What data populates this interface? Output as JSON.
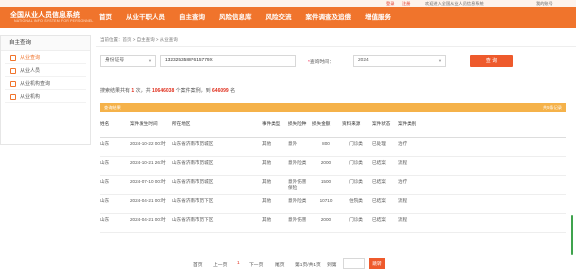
{
  "top_bar": {
    "login": "登录",
    "register": "注册",
    "welcome": "欢迎进入全国从业人员信息系统",
    "my_account": "我的账号"
  },
  "header": {
    "title": "全国从业人员信息系统",
    "subtitle": "NATIONAL INFO SYSTEM FOR PERSONNEL"
  },
  "nav": [
    "首页",
    "从业干职人员",
    "自主查询",
    "风险信息库",
    "风险交流",
    "案件调查及追偿",
    "增值服务"
  ],
  "sidebar": {
    "title": "自主查询",
    "items": [
      {
        "label": "从业查询",
        "active": true
      },
      {
        "label": "从业人员",
        "active": false
      },
      {
        "label": "从业机构查询",
        "active": false
      },
      {
        "label": "从业机构",
        "active": false
      }
    ]
  },
  "breadcrumb": "当前位置：首页 > 自主查询 > 从业查询",
  "search": {
    "type_value": "身份证号",
    "id_value": "1323253588*615779X",
    "time_label": "查询时间：",
    "year_value": "2024",
    "query_button": "查 询"
  },
  "stats": {
    "prefix": "搜索结果共有",
    "count": "1",
    "unit1": "次，共",
    "records": "10646038",
    "mid": "个案件案例，到",
    "people": "646099",
    "suffix": "名"
  },
  "results": {
    "label": "查询结果",
    "right": "共5条记录"
  },
  "table": {
    "headers": [
      "姓名",
      "案件发生时间",
      "所在地区",
      "事件类型",
      "损失险种",
      "损失金额",
      "资料来源",
      "案件状态",
      "案件类别"
    ],
    "rows": [
      [
        "山东",
        "2024-10-22 00:时",
        "山东省济南市历城区",
        "其他",
        "意外",
        "800",
        "门诊类",
        "已处理",
        "治疗"
      ],
      [
        "山东",
        "2024-10-21 26:时",
        "山东省济南市历城区",
        "其他",
        "意外险类",
        "2000",
        "门诊类",
        "已结案",
        "流程"
      ],
      [
        "山东",
        "2024-07-10 00:时",
        "山东省济南市历城区",
        "其他",
        "意外伤害保险",
        "1500",
        "门诊类",
        "已结案",
        "治疗"
      ],
      [
        "山东",
        "2024-04-21 00:时",
        "山东省济南市历下区",
        "其他",
        "意外险类",
        "10710",
        "住院类",
        "已结案",
        "流程"
      ],
      [
        "山东",
        "2024-04-21 00:时",
        "山东省济南市历下区",
        "其他",
        "意外伤害",
        "2000",
        "门诊类",
        "已结案",
        "流程"
      ]
    ]
  },
  "pager": {
    "first": "首页",
    "prev": "上一页",
    "current": "1",
    "next": "下一页",
    "last": "尾页",
    "info": "第1页/共1页",
    "goto": "到第",
    "go_button": "跳转"
  }
}
